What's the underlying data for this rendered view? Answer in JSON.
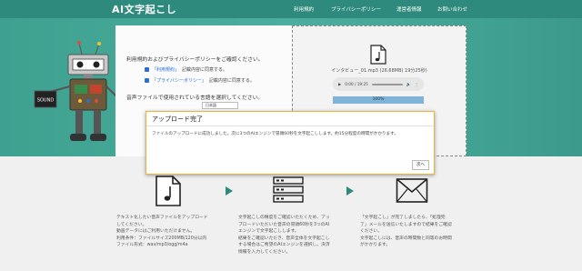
{
  "header": {
    "logo": "AI文字起こし",
    "nav": [
      "利用規約",
      "プライバシーポリシー",
      "運営者情報",
      "お問い合わせ"
    ]
  },
  "robot": {
    "card_label": "SOUND"
  },
  "consent": {
    "title": "利用規約およびプライバシーポリシーをご確認ください。",
    "items": [
      {
        "link": "「利用規約」",
        "text": "記載内容に同意する。"
      },
      {
        "link": "「プライバシーポリシー」",
        "text": "記載内容に同意する。"
      }
    ],
    "select_title": "音声ファイルで使用されている言語を選択してください。",
    "select_value": "日本語"
  },
  "upload": {
    "file_name": "インタビュー_01.mp3 (26.68MB) 19分25秒)",
    "audio_time": "0:00 / 19:25",
    "progress_label": "100%",
    "progress": 1.0
  },
  "modal": {
    "title": "アップロード完了",
    "body": "ファイルのアップロードに成功しました。次に3つのAIエンジンで冒頭60秒を文字起こしします。約15分程度の時間がかかります。",
    "next": "次へ"
  },
  "steps": [
    {
      "text": "テキスト化したい音声ファイルをアップロード\nしてください。\n動画データにはご利用いただけません。\n利用条件：ファイルサイズ200MB/120分以内\nファイル形式：wav/mp3/ogg/m4a"
    },
    {
      "text": "文字起こしの精度をご確認いただくため、アッ\nプロードいただいた音声の冒頭60秒を3つのAI\nエンジンで文字起こしします。\n結果をご確認いただき、音声全体を文字起こし\nする場合はご希望のAIエンジンを選択し、決済\n情報を入力してください。"
    },
    {
      "text": "「文字起こし」が完了しましたら、「処理完\n了」メールを送信いたしますので結果をご確認\nください。\n文字起こしには、音声の時間数と同等のお時間\nがかかります。"
    }
  ],
  "colors": {
    "brand": "#2d8a7c",
    "modal_border": "#f0b33a",
    "link": "#2a6fd6"
  },
  "icons": [
    "music-file-icon",
    "server-icon",
    "envelope-icon",
    "arrow-right-icon"
  ]
}
